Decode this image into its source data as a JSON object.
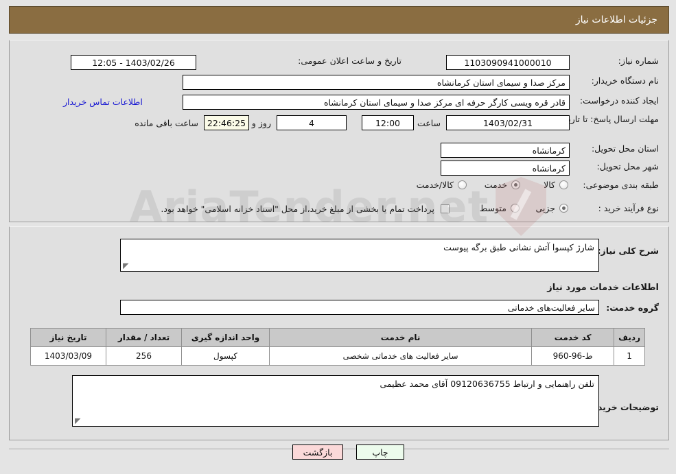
{
  "header": {
    "title": "جزئیات اطلاعات نیاز"
  },
  "form": {
    "need_number": {
      "label": "شماره نیاز:",
      "value": "1103090941000010"
    },
    "public_announce": {
      "label": "تاریخ و ساعت اعلان عمومی:",
      "value": "1403/02/26 - 12:05"
    },
    "buyer_org": {
      "label": "نام دستگاه خریدار:",
      "value": "مرکز صدا و سیمای استان کرمانشاه"
    },
    "requester": {
      "label": "ایجاد کننده درخواست:",
      "value": "قادر قره ویسی کارگر حرفه ای مرکز صدا و سیمای استان کرمانشاه"
    },
    "buyer_contact_link": "اطلاعات تماس خریدار",
    "deadline": {
      "label": "مهلت ارسال پاسخ: تا تاریخ:",
      "date": "1403/02/31",
      "time_label": "ساعت",
      "time": "12:00",
      "days": "4",
      "days_label": "روز و",
      "remaining": "22:46:25",
      "remaining_label": "ساعت باقی مانده"
    },
    "delivery_province": {
      "label": "استان محل تحویل:",
      "value": "کرمانشاه"
    },
    "delivery_city": {
      "label": "شهر محل تحویل:",
      "value": "کرمانشاه"
    },
    "category": {
      "label": "طبقه بندی موضوعی:",
      "options": [
        {
          "label": "کالا",
          "selected": false
        },
        {
          "label": "خدمت",
          "selected": true
        },
        {
          "label": "کالا/خدمت",
          "selected": false
        }
      ]
    },
    "process_type": {
      "label": "نوع فرآیند خرید :",
      "options": [
        {
          "label": "جزیی",
          "selected": true
        },
        {
          "label": "متوسط",
          "selected": false
        }
      ],
      "treasury_checkbox": false,
      "treasury_note": "پرداخت تمام یا بخشی از مبلغ خرید،از محل \"اسناد خزانه اسلامی\" خواهد بود."
    },
    "summary": {
      "label": "شرح کلی نیاز:",
      "value": "شارژ کپسوا آتش نشانی طبق برگه پیوست"
    },
    "services_section_title": "اطلاعات خدمات مورد نیاز",
    "service_group": {
      "label": "گروه خدمت:",
      "value": "سایر فعالیت‌های خدماتی"
    },
    "buyer_notes": {
      "label": "توضیحات خریدار:",
      "value": "تلفن راهنمایی و ارتباط 09120636755  آقای محمد عظیمی"
    }
  },
  "table": {
    "columns": [
      "ردیف",
      "کد خدمت",
      "نام خدمت",
      "واحد اندازه گیری",
      "تعداد / مقدار",
      "تاریخ نیاز"
    ],
    "rows": [
      {
        "index": "1",
        "code": "ط-96-960",
        "name": "سایر فعالیت های خدماتی شخصی",
        "unit": "کپسول",
        "quantity": "256",
        "need_date": "1403/03/09"
      }
    ]
  },
  "footer": {
    "print_label": "چاپ",
    "back_label": "بازگشت"
  },
  "watermark": {
    "text": "AriaTender.net"
  },
  "colors": {
    "header_bg": "#8a6d41",
    "panel_bg": "#e0e0e0",
    "link": "#1414d2",
    "table_header_bg": "#c9c9c9",
    "print_btn": "#ecfbec",
    "back_btn": "#fbd9d9"
  }
}
